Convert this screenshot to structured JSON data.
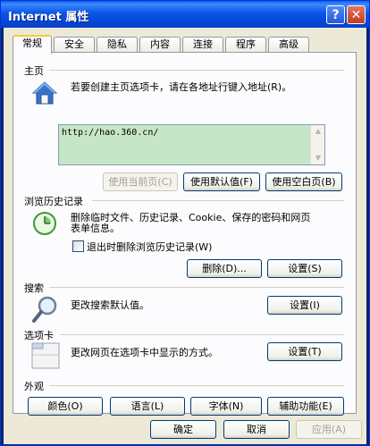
{
  "window": {
    "title": "Internet 属性",
    "help_glyph": "?",
    "close_glyph": "✕"
  },
  "tabs": [
    {
      "label": "常规"
    },
    {
      "label": "安全"
    },
    {
      "label": "隐私"
    },
    {
      "label": "内容"
    },
    {
      "label": "连接"
    },
    {
      "label": "程序"
    },
    {
      "label": "高级"
    }
  ],
  "homepage": {
    "section": "主页",
    "description": "若要创建主页选项卡，请在各地址行键入地址(R)。",
    "url": "http://hao.360.cn/",
    "buttons": {
      "use_current": "使用当前页(C)",
      "use_default": "使用默认值(F)",
      "use_blank": "使用空白页(B)"
    }
  },
  "history": {
    "section": "浏览历史记录",
    "description_line1": "删除临时文件、历史记录、Cookie、保存的密码和网页",
    "description_line2": "表单信息。",
    "checkbox_label": "退出时删除浏览历史记录(W)",
    "delete_button": "删除(D)...",
    "settings_button": "设置(S)"
  },
  "search": {
    "section": "搜索",
    "description": "更改搜索默认值。",
    "settings_button": "设置(I)"
  },
  "tabs_section": {
    "section": "选项卡",
    "description": "更改网页在选项卡中显示的方式。",
    "settings_button": "设置(T)"
  },
  "appearance": {
    "section": "外观",
    "buttons": {
      "colors": "颜色(O)",
      "languages": "语言(L)",
      "fonts": "字体(N)",
      "accessibility": "辅助功能(E)"
    }
  },
  "footer": {
    "ok": "确定",
    "cancel": "取消",
    "apply": "应用(A)"
  },
  "colors": {
    "accent": "#ffc83c",
    "titlebar": "#0b56e8",
    "url_bg": "#c7e6c7"
  }
}
